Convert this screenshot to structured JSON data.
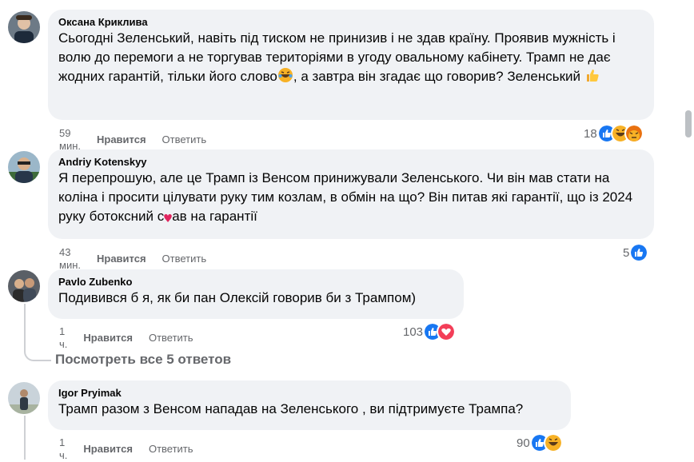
{
  "comments": [
    {
      "author": "Оксана Криклива",
      "text": "Сьогодні Зеленський, навіть під тиском не принизив і не здав країну. Проявив мужність і волю до перемоги а не торгував територіями в угоду овальному кабінету. Трамп не дає жодних гарантій, тільки його слово",
      "text_tail": ", а завтра він згадає що говорив? Зеленський ",
      "time": "59 мин.",
      "like": "Нравится",
      "reply": "Ответить",
      "reaction_count": "18",
      "reactions": [
        "like-icon",
        "haha-icon",
        "angry-icon"
      ]
    },
    {
      "author": "Andriy Kotenskyy",
      "text_a": "Я перепрошую, але це Трамп із Венсом принижували Зеленського. Чи він мав стати на коліна і просити цілувати руку тим козлам, в обмін на що? Він питав які гарантії, що із 2024 руку ботоксний с",
      "text_b": "ав на гарантії",
      "time": "43 мин.",
      "like": "Нравится",
      "reply": "Ответить",
      "reaction_count": "5",
      "reactions": [
        "like-icon"
      ]
    },
    {
      "author": "Pavlo Zubenko",
      "text": "Подивився б я, як би пан Олексій говорив би з Трампом)",
      "time": "1 ч.",
      "like": "Нравится",
      "reply": "Ответить",
      "reaction_count": "103",
      "reactions": [
        "like-icon",
        "love-icon"
      ]
    },
    {
      "author": "Igor Pryimak",
      "text": "Трамп разом з Венсом нападав на Зеленського , ви підтримуєте Трампа?",
      "time": "1 ч.",
      "like": "Нравится",
      "reply": "Ответить",
      "reaction_count": "90",
      "reactions": [
        "like-icon",
        "haha-icon"
      ]
    }
  ],
  "view_replies": "Посмотреть все 5 ответов",
  "colors": {
    "bubble": "#f0f2f5",
    "secondary_text": "#65676b",
    "like_blue": "#1877f2",
    "love_red": "#f33e58",
    "haha_yellow": "#f7b125"
  }
}
